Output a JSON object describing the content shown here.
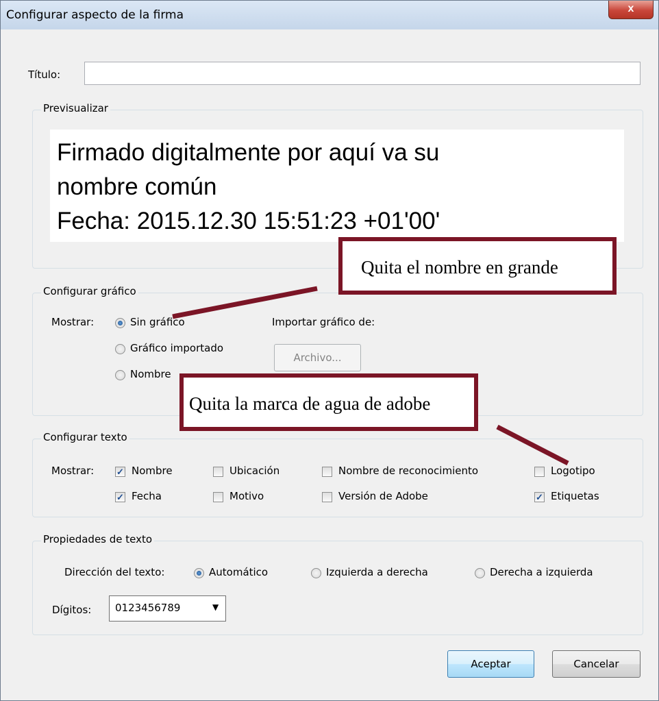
{
  "window": {
    "title": "Configurar aspecto de la firma",
    "close_glyph": "x"
  },
  "titulo": {
    "label": "Título:",
    "value": ""
  },
  "preview": {
    "group_label": "Previsualizar",
    "lines": [
      "Firmado digitalmente por aquí va su",
      "nombre común",
      "Fecha: 2015.12.30 15:51:23 +01'00'"
    ]
  },
  "graphic": {
    "group_label": "Configurar gráfico",
    "show_label": "Mostrar:",
    "options": [
      {
        "label": "Sin gráfico",
        "checked": true
      },
      {
        "label": "Gráfico importado",
        "checked": false
      },
      {
        "label": "Nombre",
        "checked": false
      }
    ],
    "import_label": "Importar gráfico de:",
    "file_button": "Archivo..."
  },
  "text_config": {
    "group_label": "Configurar texto",
    "show_label": "Mostrar:",
    "checkboxes": [
      {
        "label": "Nombre",
        "checked": true
      },
      {
        "label": "Ubicación",
        "checked": false
      },
      {
        "label": "Nombre de reconocimiento",
        "checked": false
      },
      {
        "label": "Logotipo",
        "checked": false
      },
      {
        "label": "Fecha",
        "checked": true
      },
      {
        "label": "Motivo",
        "checked": false
      },
      {
        "label": "Versión de Adobe",
        "checked": false
      },
      {
        "label": "Etiquetas",
        "checked": true
      }
    ]
  },
  "text_props": {
    "group_label": "Propiedades de texto",
    "direction_label": "Dirección del texto:",
    "directions": [
      {
        "label": "Automático",
        "checked": true
      },
      {
        "label": "Izquierda a derecha",
        "checked": false
      },
      {
        "label": "Derecha a izquierda",
        "checked": false
      }
    ],
    "digits_label": "Dígitos:",
    "digits_value": "0123456789"
  },
  "buttons": {
    "ok": "Aceptar",
    "cancel": "Cancelar"
  },
  "annotations": {
    "callout_1": "Quita el nombre en grande",
    "callout_2": "Quita la marca de agua de adobe",
    "color": "#7b1526"
  }
}
